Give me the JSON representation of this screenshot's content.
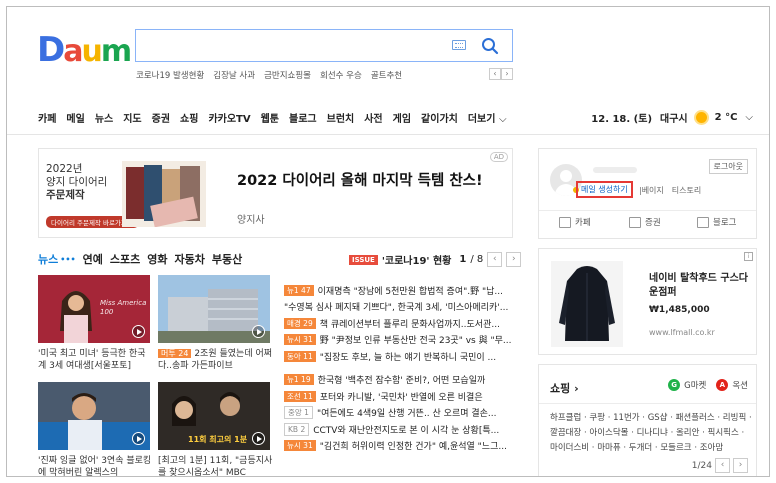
{
  "brand": {
    "logo_letters": [
      "D",
      "a",
      "u",
      "m"
    ],
    "logo_colors": [
      "#3a6fe0",
      "#e84a3a",
      "#f5b400",
      "#2b5fd9",
      "#e84a3a",
      "#1aa550"
    ]
  },
  "search": {
    "trending": [
      "코로나19 발생현황",
      "김장날 사과",
      "금반지쇼핑몰",
      "회선수 우승",
      "골트추천"
    ],
    "prev_label": "‹",
    "next_label": "›"
  },
  "nav": {
    "items": [
      "카페",
      "메일",
      "뉴스",
      "지도",
      "증권",
      "쇼핑",
      "카카오TV",
      "웹툰",
      "블로그",
      "브런치",
      "사전",
      "게임",
      "같이가치",
      "더보기"
    ],
    "more_caret": "⌵",
    "date": "12. 18. (토)",
    "location": "대구시",
    "temperature": "2 °C",
    "temp_caret": "⌵"
  },
  "banner": {
    "line1": "2022년",
    "line2": "양지 다이어리",
    "line3": "주문제작",
    "tag": "다이어리 주문제작 바로가기 >",
    "title": "2022 다이어리 올해 마지막 득템 찬스!",
    "sponsor": "양지사",
    "ad_label": "AD"
  },
  "news_tabs": {
    "items": [
      "뉴스",
      "연예",
      "스포츠",
      "영화",
      "자동차",
      "부동산"
    ],
    "dots": "•••",
    "issue_label": "ISSUE",
    "issue_title": "'코로나19' 현황",
    "page": "1",
    "total": "/ 8",
    "prev": "‹",
    "next": "›"
  },
  "photos": [
    {
      "caption": "'미국 최고 미녀' 등극한 한국계 3세 여대생[서울포토]",
      "tag": "",
      "overlay": "Miss America 100"
    },
    {
      "caption": "2조원 들였는데 어쩌다..송파 가든파이브",
      "tag": "머투 24",
      "overlay": ""
    },
    {
      "caption": "'진짜 잉글 없어' 3연속 블로킹에 막혀버린 알렉스의",
      "tag": "",
      "overlay": ""
    },
    {
      "caption": "[최고의 1분] 11회, \"금등지사를 찾으시옵소서\" MBC",
      "tag": "",
      "overlay": "11회 최고의 1분"
    }
  ],
  "headlines": [
    {
      "tag": "뉴1 47",
      "text": "이재명측 \"장남에 5천만원 합법적 증여\".野 \"납...",
      "gray": false
    },
    {
      "tag": "",
      "text": "\"수영복 심사 폐지돼 기쁘다\", 한국계 3세, '미스아메리카'...",
      "gray": false
    },
    {
      "tag": "매경 29",
      "text": "책 큐레이션부터 플루리 문화사업까지..도서관...",
      "gray": false
    },
    {
      "tag": "뉴시 31",
      "text": "野 \"尹정보 인류 부동산만 전국 23곳\" vs 與 \"무...",
      "gray": false
    },
    {
      "tag": "동아 11",
      "text": "\"집장도 후보, 늘 하는 얘기 반복하니 국민이 ...",
      "gray": false
    },
    {
      "tag": "뉴1 19",
      "text": "한국형 '백추전 잠수함' 준비?, 어떤 모습일까",
      "gray": false
    },
    {
      "tag": "조선 11",
      "text": "포터와 카니발, '국민차' 반열에 오른 비결은",
      "gray": false
    },
    {
      "tag": "중앙 1",
      "text": "\"여든에도 4색9일 산행 거뜬.. 산 오르며 결손...",
      "gray": true
    },
    {
      "tag": "KB 2",
      "text": "CCTV와 재난안전지도로 본 이 시각 눈 상황[특...",
      "gray": true
    },
    {
      "tag": "뉴시 31",
      "text": "\"김건희 허위이력 인정한 건가\" 예,윤석열 \"느그...",
      "gray": false
    }
  ],
  "login": {
    "logout": "로그아웃",
    "mail_create": "메일 생성하기",
    "link_neighbor": "|베이지",
    "link_tistory": "티스토리",
    "services": [
      "카페",
      "증권",
      "블로그"
    ]
  },
  "shop_ad": {
    "title": "네이비 탈착후드 구스다운점퍼",
    "price": "₩1,485,000",
    "url": "www.lfmall.co.kr",
    "info_label": "i"
  },
  "shopping": {
    "title": "쇼핑",
    "arrow": "›",
    "gmarket_label": "G마켓",
    "gmarket_icon": "G",
    "auction_label": "옥션",
    "auction_icon": "A",
    "list": "하프클럽 · 쿠팡 · 11번가 · GS샵 · 패션플러스 · 리빙픽 · 깔끔대장 · 아이스닥몰 · 디나디냐 · 올리안 · 픽시픽스 · 마이더스비 · 마마퓨 · 두개더 · 모들르크 · 조아맘",
    "page": "1/24",
    "prev": "‹",
    "next": "›"
  }
}
